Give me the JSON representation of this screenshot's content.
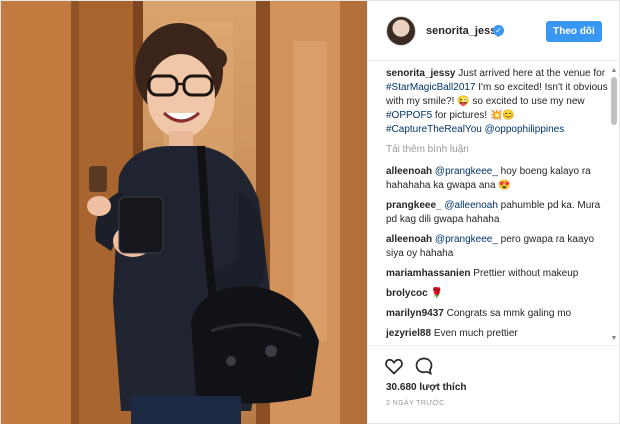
{
  "post": {
    "username": "senorita_jessy",
    "follow_label": "Theo dõi",
    "caption": {
      "user": "senorita_jessy",
      "parts": [
        {
          "text": "Just arrived here at the venue for ",
          "link": false
        },
        {
          "text": "#StarMagicBall2017",
          "link": true
        },
        {
          "text": " I'm so excited! Isn't it obvious with my smile?! 😜 so excited to use my new ",
          "link": false
        },
        {
          "text": "#OPPOF5",
          "link": true
        },
        {
          "text": " for pictures! 💥😊",
          "link": false
        },
        {
          "text": "#CaptureTheRealYou",
          "link": true
        },
        {
          "text": " ",
          "link": false
        },
        {
          "text": "@oppophilippines",
          "link": true
        }
      ]
    },
    "load_more_label": "Tải thêm bình luận",
    "comments": [
      {
        "user": "alleenoah",
        "parts": [
          {
            "text": "@prangkeee_",
            "link": true
          },
          {
            "text": " hoy boeng kalayo ra hahahaha ka gwapa ana 😍",
            "link": false
          }
        ]
      },
      {
        "user": "prangkeee_",
        "parts": [
          {
            "text": "@alleenoah",
            "link": true
          },
          {
            "text": " pahumble pd ka. Mura pd kag dili gwapa hahaha",
            "link": false
          }
        ]
      },
      {
        "user": "alleenoah",
        "parts": [
          {
            "text": "@prangkeee_",
            "link": true
          },
          {
            "text": " pero gwapa ra kaayo siya oy hahaha",
            "link": false
          }
        ]
      },
      {
        "user": "mariamhassanien",
        "parts": [
          {
            "text": "Prettier without makeup",
            "link": false
          }
        ]
      },
      {
        "user": "brolycoc",
        "parts": [
          {
            "text": "🌹",
            "link": false
          }
        ]
      },
      {
        "user": "marilyn9437",
        "parts": [
          {
            "text": "Congrats sa mmk galing mo",
            "link": false
          }
        ]
      },
      {
        "user": "jezyriel88",
        "parts": [
          {
            "text": "Even much prettier",
            "link": false
          }
        ]
      }
    ],
    "likes_label": "30.680 lượt thích",
    "time_label": "2 NGÀY TRƯỚC"
  },
  "icons": {
    "verified": "verified-badge-icon",
    "like": "heart-icon",
    "comment": "comment-bubble-icon",
    "scroll_up": "scroll-up-arrow-icon",
    "scroll_down": "scroll-down-arrow-icon"
  },
  "colors": {
    "accent": "#3897f0",
    "link": "#003569",
    "muted": "#999999",
    "photo_wall": "#c98449"
  }
}
